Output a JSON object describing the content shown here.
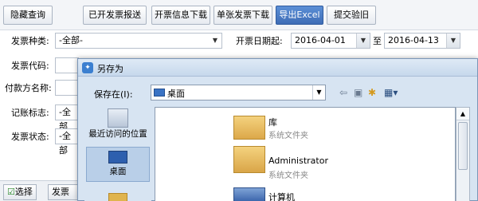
{
  "toolbar": {
    "buttons": [
      "隐藏查询",
      "已开发票报送",
      "开票信息下载",
      "单张发票下载",
      "导出Excel",
      "提交验旧"
    ]
  },
  "form": {
    "invoice_type_label": "发票种类:",
    "invoice_type_value": "-全部-",
    "invoice_date_label": "开票日期起:",
    "date_from": "2016-04-01",
    "date_to_label": "至",
    "date_to": "2016-04-13",
    "invoice_code_label": "发票代码:",
    "payer_name_label": "付款方名称:",
    "posting_flag_label": "记账标志:",
    "posting_flag_value": "-全部",
    "invoice_status_label": "发票状态:",
    "invoice_status_value": "-全部"
  },
  "bottom": {
    "select_label": "选择",
    "invoice_type_partial": "发票种"
  },
  "dialog": {
    "title": "另存为",
    "save_in_label": "保存在(I):",
    "save_in_value": "桌面",
    "places": [
      {
        "label": "最近访问的位置"
      },
      {
        "label": "桌面"
      }
    ],
    "files": [
      {
        "name": "库",
        "type": "系统文件夹"
      },
      {
        "name": "Administrator",
        "type": "系统文件夹"
      },
      {
        "name": "计算机",
        "type": ""
      }
    ]
  }
}
